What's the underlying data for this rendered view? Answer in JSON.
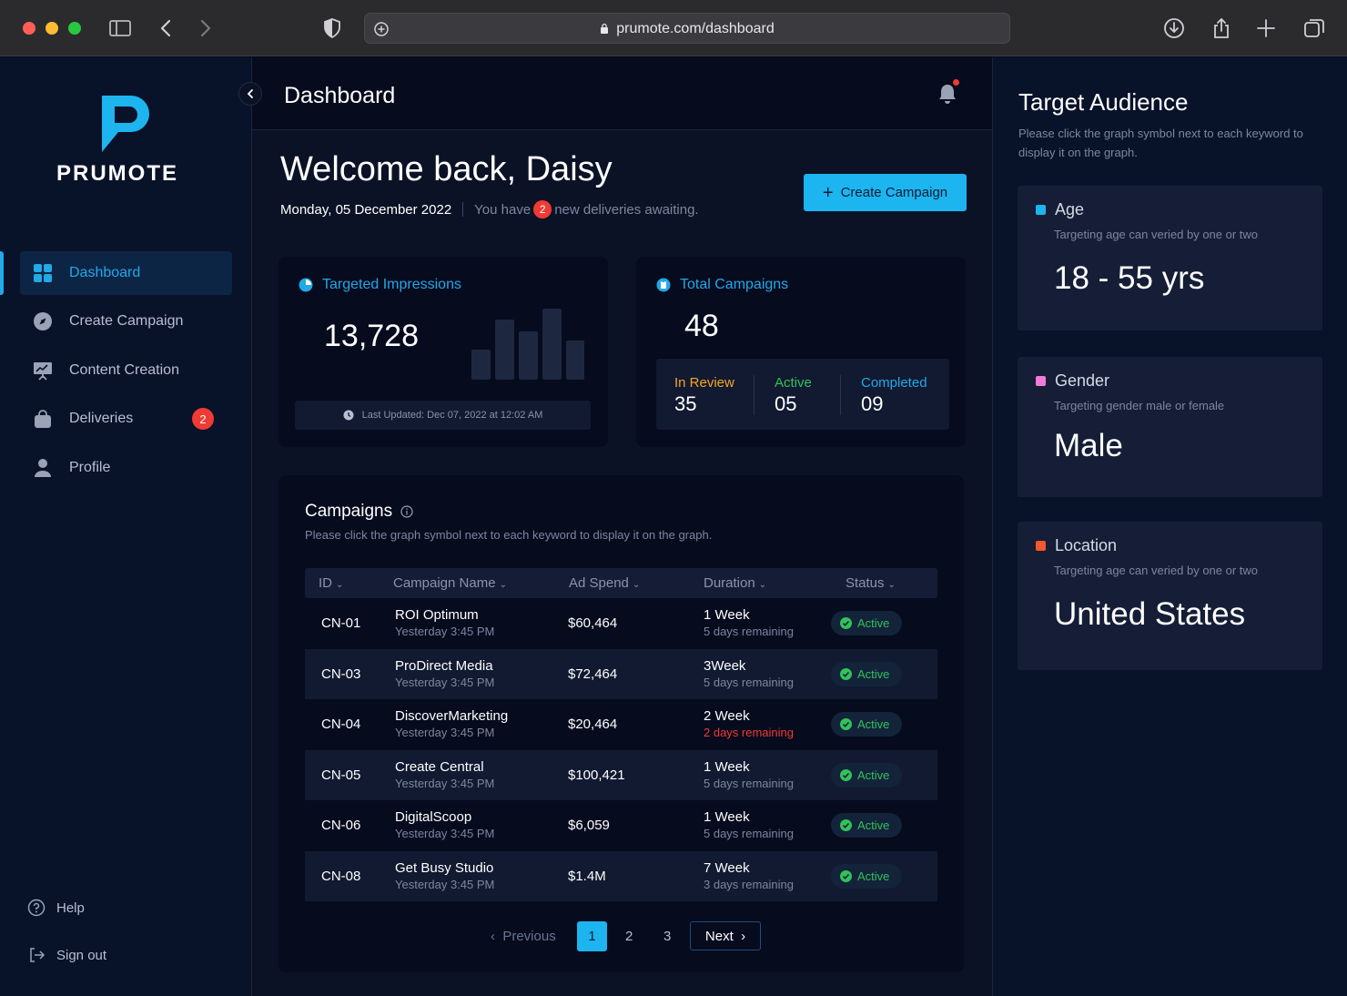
{
  "browser": {
    "url": "prumote.com/dashboard"
  },
  "brand": {
    "name": "PRUMOTE",
    "accent": "#1cb5f0"
  },
  "sidebar": {
    "items": [
      {
        "label": "Dashboard",
        "icon": "grid-icon",
        "active": true
      },
      {
        "label": "Create Campaign",
        "icon": "compass-icon"
      },
      {
        "label": "Content Creation",
        "icon": "presentation-icon"
      },
      {
        "label": "Deliveries",
        "icon": "shopping-bag-icon",
        "badge": "2"
      },
      {
        "label": "Profile",
        "icon": "user-icon"
      }
    ],
    "help": "Help",
    "signout": "Sign out"
  },
  "header": {
    "title": "Dashboard"
  },
  "welcome": {
    "heading": "Welcome back, Daisy",
    "date": "Monday, 05 December 2022",
    "you_have": "You have",
    "count": "2",
    "deliveries_text": "new deliveries awaiting.",
    "create_button": "Create Campaign"
  },
  "impressions": {
    "title": "Targeted Impressions",
    "value": "13,728",
    "updated": "Last Updated: Dec 07, 2022 at 12:02 AM",
    "bars": [
      0.42,
      0.84,
      0.68,
      1.0,
      0.55
    ]
  },
  "campaigns_total": {
    "title": "Total Campaigns",
    "value": "48",
    "stats": [
      {
        "label": "In Review",
        "value": "35",
        "color": "#f5a623"
      },
      {
        "label": "Active",
        "value": "05",
        "color": "#33c15a"
      },
      {
        "label": "Completed",
        "value": "09",
        "color": "#23a8e8"
      }
    ]
  },
  "campaigns": {
    "title": "Campaigns",
    "subtitle": "Please click the graph symbol next to each keyword to display it on the graph.",
    "columns": [
      "ID",
      "Campaign Name",
      "Ad Spend",
      "Duration",
      "Status"
    ],
    "rows": [
      {
        "id": "CN-01",
        "name": "ROI Optimum",
        "time": "Yesterday 3:45 PM",
        "spend": "$60,464",
        "duration": "1 Week",
        "remaining": "5 days remaining",
        "warn": false,
        "status": "Active"
      },
      {
        "id": "CN-03",
        "name": "ProDirect Media",
        "time": "Yesterday 3:45 PM",
        "spend": "$72,464",
        "duration": "3Week",
        "remaining": "5 days remaining",
        "warn": false,
        "status": "Active"
      },
      {
        "id": "CN-04",
        "name": "DiscoverMarketing",
        "time": "Yesterday 3:45 PM",
        "spend": "$20,464",
        "duration": "2 Week",
        "remaining": "2 days remaining",
        "warn": true,
        "status": "Active"
      },
      {
        "id": "CN-05",
        "name": "Create Central",
        "time": "Yesterday 3:45 PM",
        "spend": "$100,421",
        "duration": "1 Week",
        "remaining": "5 days remaining",
        "warn": false,
        "status": "Active"
      },
      {
        "id": "CN-06",
        "name": "DigitalScoop",
        "time": "Yesterday 3:45 PM",
        "spend": "$6,059",
        "duration": "1 Week",
        "remaining": "5 days remaining",
        "warn": false,
        "status": "Active"
      },
      {
        "id": "CN-08",
        "name": "Get Busy Studio",
        "time": "Yesterday 3:45 PM",
        "spend": "$1.4M",
        "duration": "7 Week",
        "remaining": "3 days remaining",
        "warn": false,
        "status": "Active"
      }
    ],
    "pagination": {
      "previous": "Previous",
      "pages": [
        "1",
        "2",
        "3"
      ],
      "current": "1",
      "next": "Next"
    }
  },
  "audience": {
    "title": "Target Audience",
    "subtitle": "Please click the graph symbol next to each keyword to display it on the graph.",
    "cards": [
      {
        "label": "Age",
        "hint": "Targeting age can veried by one or two",
        "value": "18 - 55 yrs",
        "color": "#1cb5f0"
      },
      {
        "label": "Gender",
        "hint": "Targeting gender male or female",
        "value": "Male",
        "color": "#f47ad8"
      },
      {
        "label": "Location",
        "hint": "Targeting age can veried by one or two",
        "value": "United States",
        "color": "#f0582e"
      }
    ]
  }
}
